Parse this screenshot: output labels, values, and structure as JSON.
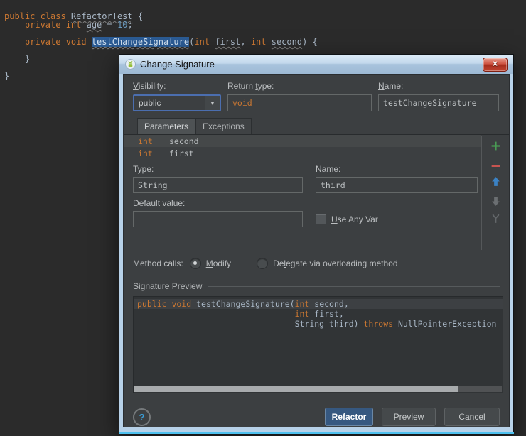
{
  "editor": {
    "lines": [
      {
        "hl": false,
        "tokens": [
          [
            "public class ",
            "kw"
          ],
          [
            "RefactorTest",
            "id u"
          ],
          [
            " {",
            "pl"
          ]
        ]
      },
      {
        "hl": false,
        "tokens": [
          [
            "    ",
            "pl"
          ],
          [
            "private int ",
            "kw"
          ],
          [
            "age",
            "id u"
          ],
          [
            " = ",
            "pl"
          ],
          [
            "10",
            "num"
          ],
          [
            ";",
            "pl"
          ]
        ]
      },
      {
        "hl": false,
        "tokens": []
      },
      {
        "hl": false,
        "tokens": [
          [
            "    ",
            "pl"
          ],
          [
            "private void ",
            "kw"
          ],
          [
            "testChangeSignature",
            "sel u"
          ],
          [
            "(",
            "pl"
          ],
          [
            "int ",
            "kw"
          ],
          [
            "first",
            "id u"
          ],
          [
            ", ",
            "pl"
          ],
          [
            "int ",
            "kw"
          ],
          [
            "second",
            "id u"
          ],
          [
            ") {",
            "pl"
          ]
        ]
      },
      {
        "hl": false,
        "tokens": []
      },
      {
        "hl": false,
        "tokens": [
          [
            "    }",
            "pl"
          ]
        ]
      },
      {
        "hl": false,
        "tokens": []
      },
      {
        "hl": false,
        "tokens": [
          [
            "}",
            "pl"
          ]
        ]
      }
    ]
  },
  "dialog": {
    "title": "Change Signature",
    "fields": {
      "visibility": {
        "label": {
          "pre": "",
          "u": "V",
          "post": "isibility:"
        },
        "value": "public"
      },
      "return_type": {
        "label": {
          "pre": "Return ",
          "u": "t",
          "post": "ype:"
        },
        "value": "void"
      },
      "name": {
        "label": {
          "pre": "",
          "u": "N",
          "post": "ame:"
        },
        "value": "testChangeSignature"
      }
    },
    "tabs": {
      "parameters": "Parameters",
      "exceptions": "Exceptions"
    },
    "params": [
      {
        "type": "int",
        "name": "second"
      },
      {
        "type": "int",
        "name": "first"
      }
    ],
    "param_editor": {
      "type_label": "Type:",
      "type_value": "String",
      "name_label": "Name:",
      "name_value": "third",
      "default_label": "Default value:",
      "default_value": "",
      "use_any_var": {
        "pre": "",
        "u": "U",
        "post": "se Any Var"
      }
    },
    "method_calls": {
      "label": "Method calls:",
      "modify": {
        "pre": "",
        "u": "M",
        "post": "odify"
      },
      "delegate": {
        "pre": "De",
        "u": "l",
        "post": "egate via overloading method"
      }
    },
    "signature_preview": {
      "label": "Signature Preview",
      "lines": [
        {
          "hl": true,
          "tokens": [
            [
              "public void ",
              "kw"
            ],
            [
              "testChangeSignature(",
              "pl"
            ],
            [
              "int ",
              "kw"
            ],
            [
              "second,",
              "pl"
            ]
          ]
        },
        {
          "hl": false,
          "tokens": [
            [
              "                                ",
              "pl"
            ],
            [
              "int ",
              "kw"
            ],
            [
              "first,",
              "pl"
            ]
          ]
        },
        {
          "hl": false,
          "tokens": [
            [
              "                                ",
              "pl"
            ],
            [
              "String third) ",
              "pl"
            ],
            [
              "throws",
              "kw"
            ],
            [
              " NullPointerException",
              "pl"
            ]
          ]
        }
      ]
    },
    "buttons": {
      "refactor": "Refactor",
      "preview": "Preview",
      "cancel": "Cancel"
    },
    "icons": {
      "help": "?",
      "close": "×",
      "dropdown": "▼"
    }
  },
  "colors": {
    "editor_bg": "#2b2b2b",
    "panel_bg": "#3c3f41",
    "keyword": "#cc7832",
    "identifier": "#a9b7c6",
    "number": "#6897bb",
    "selection": "#2b5b94",
    "focus_ring": "#4b6eaf",
    "refactor_button": "#365880",
    "titlebar_top": "#dcebf7",
    "titlebar_bottom": "#9db9d4",
    "frame_blue": "#b7d1e8",
    "frame_accent": "#4dc0ee",
    "add_icon": "#499c54",
    "remove_icon": "#c75450",
    "up_icon": "#3b82c4"
  }
}
